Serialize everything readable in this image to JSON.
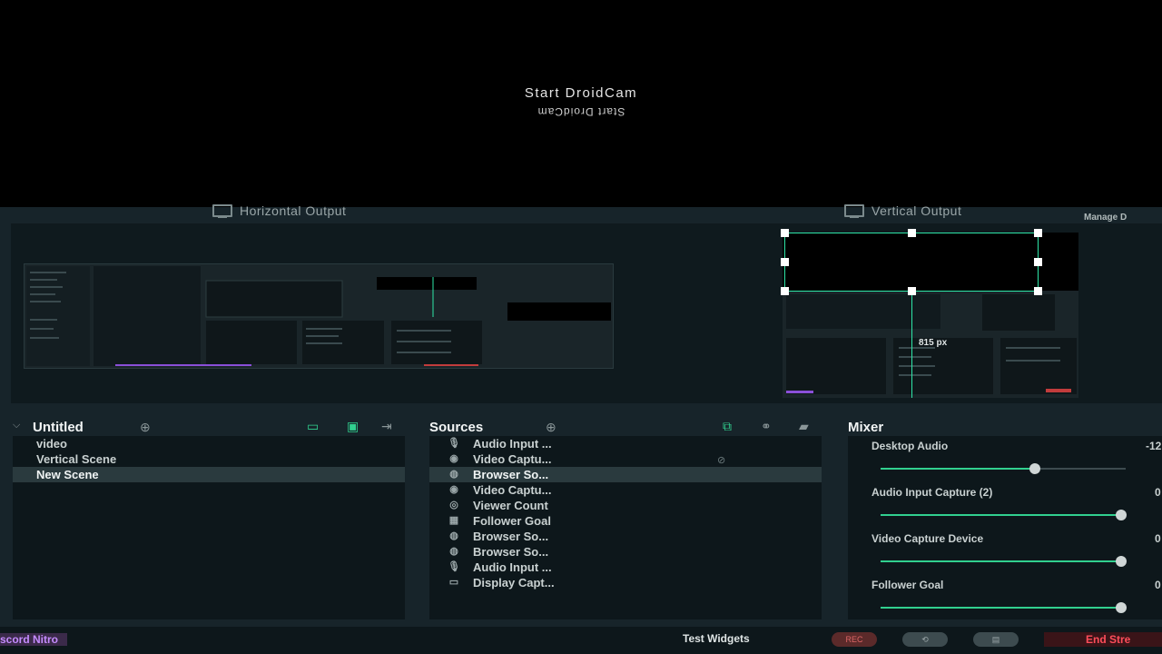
{
  "camera": {
    "title": "Start DroidCam",
    "mirrored_text": "Start DroidCam"
  },
  "outputs": {
    "horizontal": "Horizontal Output",
    "vertical": "Vertical Output",
    "manage": "Manage D",
    "vertical_dim": "815 px"
  },
  "scenes": {
    "header": "Untitled",
    "items": [
      "video",
      "Vertical Scene",
      "New Scene"
    ],
    "selected_index": 2
  },
  "sources": {
    "header": "Sources",
    "items": [
      {
        "label": "Audio Input ...",
        "icon": "microphone-icon"
      },
      {
        "label": "Video Captu...",
        "icon": "webcam-icon"
      },
      {
        "label": "Browser So...",
        "icon": "globe-icon"
      },
      {
        "label": "Video Captu...",
        "icon": "webcam-icon"
      },
      {
        "label": "Viewer Count",
        "icon": "eye-icon"
      },
      {
        "label": "Follower Goal",
        "icon": "calendar-icon"
      },
      {
        "label": "Browser So...",
        "icon": "globe-icon"
      },
      {
        "label": "Browser So...",
        "icon": "globe-icon"
      },
      {
        "label": "Audio Input ...",
        "icon": "microphone-icon"
      },
      {
        "label": "Display Capt...",
        "icon": "monitor-icon"
      }
    ],
    "selected_index": 2
  },
  "mixer": {
    "header": "Mixer",
    "items": [
      {
        "label": "Desktop Audio",
        "value": "-12",
        "level": 0.63
      },
      {
        "label": "Audio Input Capture (2)",
        "value": "0",
        "level": 0.98
      },
      {
        "label": "Video Capture Device",
        "value": "0",
        "level": 0.98
      },
      {
        "label": "Follower Goal",
        "value": "0",
        "level": 0.98
      }
    ]
  },
  "footer": {
    "nitro": "scord Nitro",
    "test_widgets": "Test Widgets",
    "rec": "REC",
    "end_stream": "End Stre"
  },
  "colors": {
    "accent": "#31d08f",
    "background": "#17242a",
    "danger": "#ff4d5a"
  }
}
